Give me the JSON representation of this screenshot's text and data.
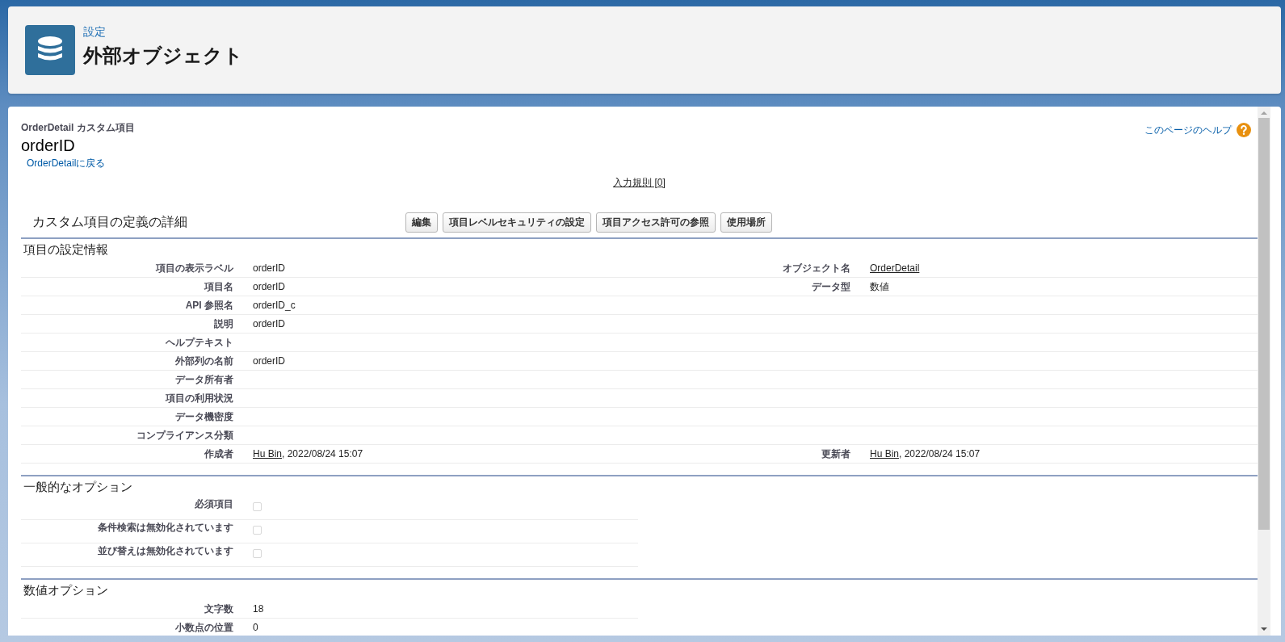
{
  "header": {
    "breadcrumb": "設定",
    "title": "外部オブジェクト"
  },
  "record": {
    "object_label": "OrderDetail カスタム項目",
    "title": "orderID",
    "back_link": "OrderDetailに戻る",
    "help_link": "このページのヘルプ",
    "related_link": "入力規則 [0]"
  },
  "detail": {
    "title": "カスタム項目の定義の詳細",
    "buttons": [
      "編集",
      "項目レベルセキュリティの設定",
      "項目アクセス許可の参照",
      "使用場所"
    ]
  },
  "sections": [
    {
      "title": "項目の設定情報",
      "kind": "two-column",
      "rows": [
        {
          "cells": [
            {
              "label": "項目の表示ラベル",
              "value": "orderID"
            },
            {
              "label": "オブジェクト名",
              "link": "OrderDetail"
            }
          ]
        },
        {
          "cells": [
            {
              "label": "項目名",
              "value": "orderID"
            },
            {
              "label": "データ型",
              "value": "数値"
            }
          ]
        },
        {
          "cells": [
            {
              "label": "API 参照名",
              "value": "orderID_c"
            }
          ]
        },
        {
          "cells": [
            {
              "label": "説明",
              "value": "orderID"
            }
          ]
        },
        {
          "cells": [
            {
              "label": "ヘルプテキスト"
            }
          ]
        },
        {
          "cells": [
            {
              "label": "外部列の名前",
              "value": "orderID"
            }
          ]
        },
        {
          "cells": [
            {
              "label": "データ所有者"
            }
          ]
        },
        {
          "cells": [
            {
              "label": "項目の利用状況"
            }
          ]
        },
        {
          "cells": [
            {
              "label": "データ機密度"
            }
          ]
        },
        {
          "cells": [
            {
              "label": "コンプライアンス分類"
            }
          ]
        },
        {
          "cells": [
            {
              "label": "作成者",
              "link": "Hu Bin",
              "value": ", 2022/08/24 15:07"
            },
            {
              "label": "更新者",
              "link": "Hu Bin",
              "value": ", 2022/08/24 15:07"
            }
          ]
        }
      ]
    },
    {
      "title": "一般的なオプション",
      "kind": "checkboxes",
      "rows": [
        {
          "label": "必須項目",
          "checked": false
        },
        {
          "label": "条件検索は無効化されています",
          "checked": false
        },
        {
          "label": "並び替えは無効化されています",
          "checked": false
        }
      ]
    },
    {
      "title": "数値オプション",
      "kind": "one-column",
      "rows": [
        {
          "cells": [
            {
              "label": "文字数",
              "value": "18"
            }
          ]
        },
        {
          "cells": [
            {
              "label": "小数点の位置",
              "value": "0"
            }
          ]
        }
      ]
    }
  ]
}
